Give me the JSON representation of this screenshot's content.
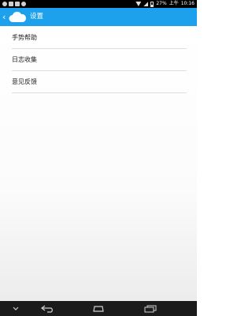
{
  "status_bar": {
    "battery": "27%",
    "time_prefix": "上午",
    "time": "10:16"
  },
  "action_bar": {
    "title": "设置",
    "back_icon": "chevron-left-icon",
    "app_icon": "cloud-icon",
    "background_color": "#1ea1ec"
  },
  "menu": {
    "items": [
      {
        "label": "手势帮助"
      },
      {
        "label": "日志收集"
      },
      {
        "label": "意见反馈"
      }
    ]
  },
  "nav_bar": {
    "buttons": [
      "hide-keyboard-icon",
      "back-icon",
      "home-icon",
      "recent-apps-icon"
    ]
  }
}
